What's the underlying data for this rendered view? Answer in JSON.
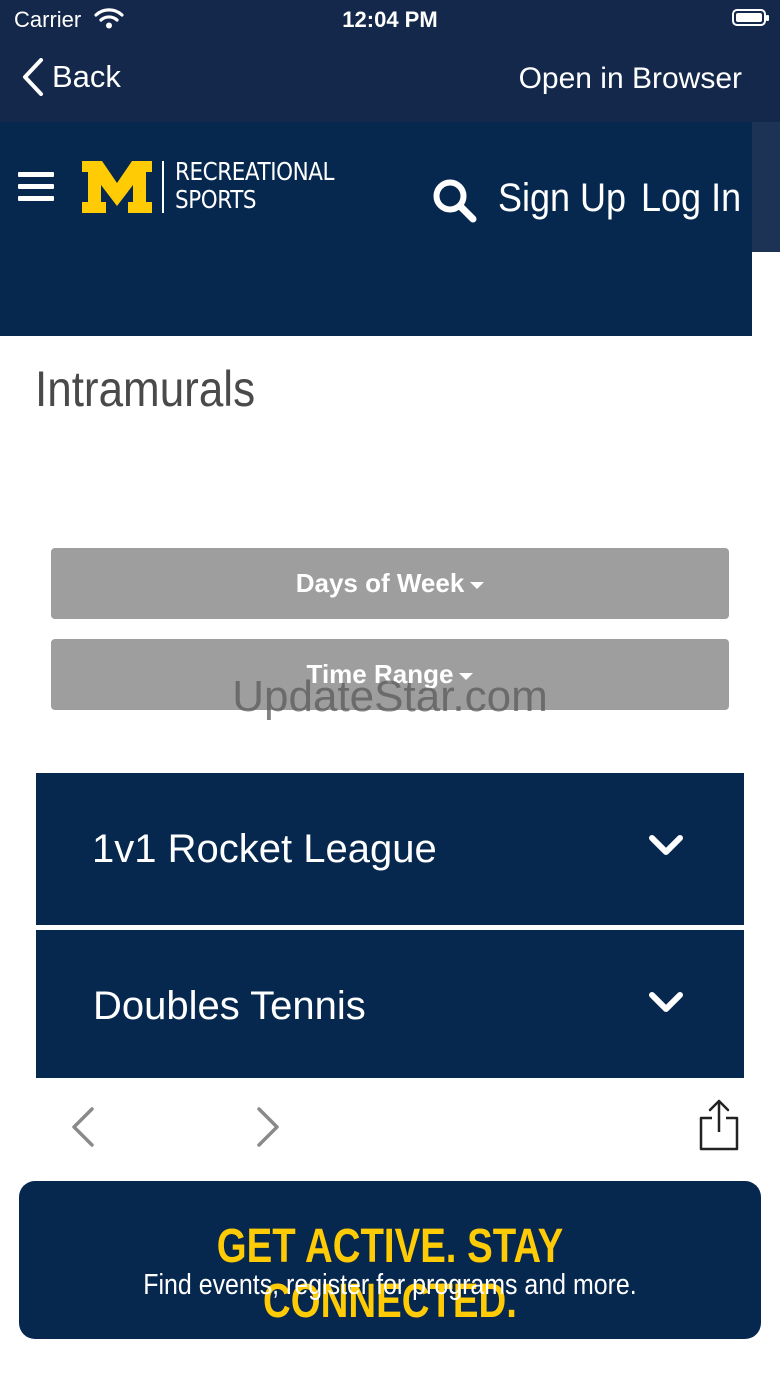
{
  "status_bar": {
    "carrier": "Carrier",
    "time": "12:04 PM"
  },
  "nav_bar": {
    "back_label": "Back",
    "open_in_browser_label": "Open in Browser"
  },
  "site_header": {
    "logo_line1": "RECREATIONAL",
    "logo_line2": "SPORTS",
    "sign_up": "Sign Up",
    "log_in": "Log In",
    "logo_color": "#ffcb05",
    "header_color": "#06284f"
  },
  "main": {
    "page_title": "Intramurals",
    "filters": [
      {
        "label": "Days of Week"
      },
      {
        "label": "Time Range"
      }
    ],
    "sports": [
      {
        "label": "1v1 Rocket League"
      },
      {
        "label": "Doubles Tennis"
      }
    ]
  },
  "watermark": "UpdateStar.com",
  "banner": {
    "headline": "GET ACTIVE.  STAY CONNECTED.",
    "subtext": "Find events, register for programs and more.",
    "headline_color": "#ffcb05"
  }
}
